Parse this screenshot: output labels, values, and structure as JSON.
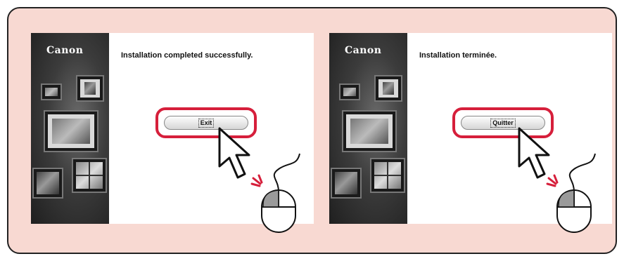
{
  "panels": [
    {
      "logo": "Canon",
      "message": "Installation completed successfully.",
      "button_label": "Exit"
    },
    {
      "logo": "Canon",
      "message": "Installation terminée.",
      "button_label": "Quitter"
    }
  ],
  "colors": {
    "frame_background": "#f8d9d2",
    "highlight": "#d61f3b",
    "sidebar": "#3c3c3c"
  },
  "icons": [
    "arrow-cursor-icon",
    "mouse-icon",
    "click-spark-icon"
  ]
}
